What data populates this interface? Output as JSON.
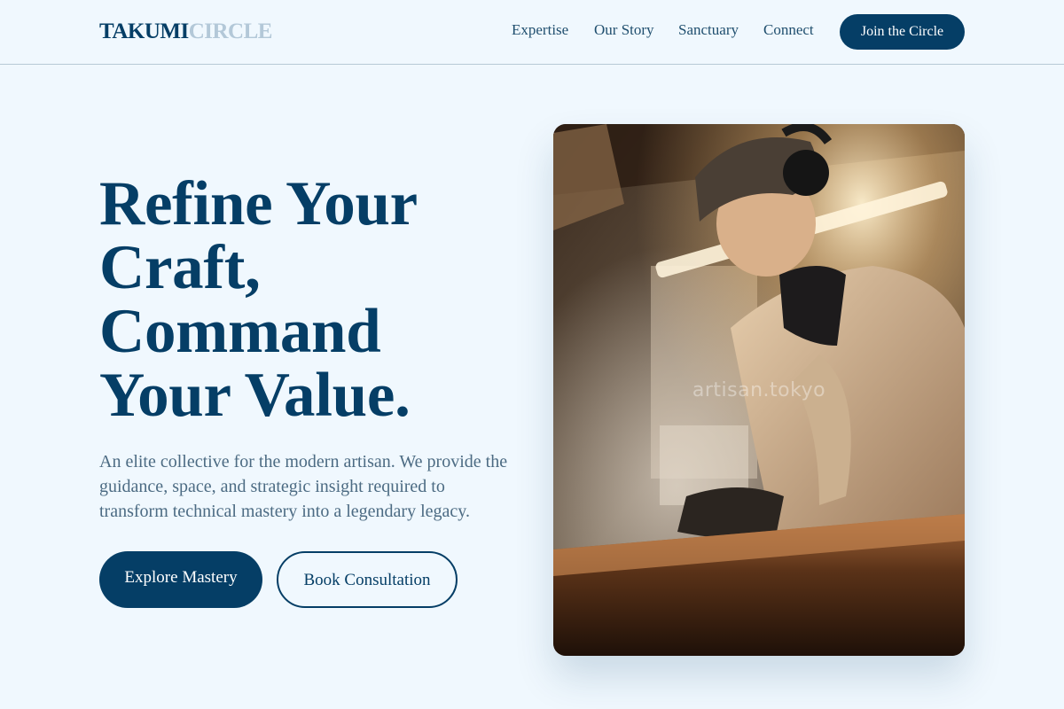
{
  "brand": {
    "part1": "TAKUMI",
    "part2": "CIRCLE"
  },
  "nav": {
    "items": [
      {
        "label": "Expertise"
      },
      {
        "label": "Our Story"
      },
      {
        "label": "Sanctuary"
      },
      {
        "label": "Connect"
      }
    ],
    "cta_label": "Join the Circle"
  },
  "hero": {
    "title_lines": [
      "Refine Your",
      "Craft,",
      "Command",
      "Your Value."
    ],
    "description": "An elite collective for the modern artisan. We provide the guidance, space, and strategic insight required to transform technical mastery into a legendary legacy.",
    "primary_button": "Explore Mastery",
    "secondary_button": "Book Consultation",
    "image_watermark": "artisan.tokyo",
    "image_alt": "Artisan in cap and headphones working at a smoky workbench"
  },
  "colors": {
    "background": "#f0f8fe",
    "primary": "#053e66",
    "logo_accent": "#b3c8d8",
    "body_text": "#4c6b83"
  }
}
